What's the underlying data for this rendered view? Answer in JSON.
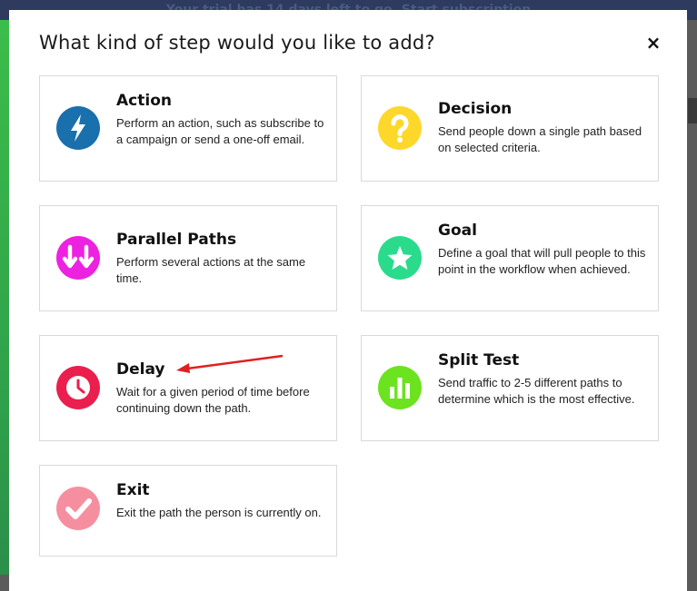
{
  "banner": {
    "text": "Your trial has 14 days left to go. Start subscription"
  },
  "modal": {
    "title": "What kind of step would you like to add?",
    "close_label": "×"
  },
  "cards": [
    {
      "title": "Action",
      "description": "Perform an action, such as subscribe to a campaign or send a one-off email.",
      "icon": "lightning-icon",
      "color": "#1a6fad"
    },
    {
      "title": "Decision",
      "description": "Send people down a single path based on selected criteria.",
      "icon": "question-mark-icon",
      "color": "#fdd82b"
    },
    {
      "title": "Parallel Paths",
      "description": "Perform several actions at the same time.",
      "icon": "parallel-arrows-icon",
      "color": "#ec22e0"
    },
    {
      "title": "Goal",
      "description": "Define a goal that will pull people to this point in the workflow when achieved.",
      "icon": "star-icon",
      "color": "#2bdb8c"
    },
    {
      "title": "Delay",
      "description": "Wait for a given period of time before continuing down the path.",
      "icon": "clock-icon",
      "color": "#ea1f4d"
    },
    {
      "title": "Split Test",
      "description": "Send traffic to 2-5 different paths to determine which is the most effective.",
      "icon": "bar-chart-icon",
      "color": "#6be31f"
    },
    {
      "title": "Exit",
      "description": "Exit the path the person is currently on.",
      "icon": "checkmark-icon",
      "color": "#f58fa0"
    }
  ],
  "annotation": {
    "color": "#e02020"
  }
}
